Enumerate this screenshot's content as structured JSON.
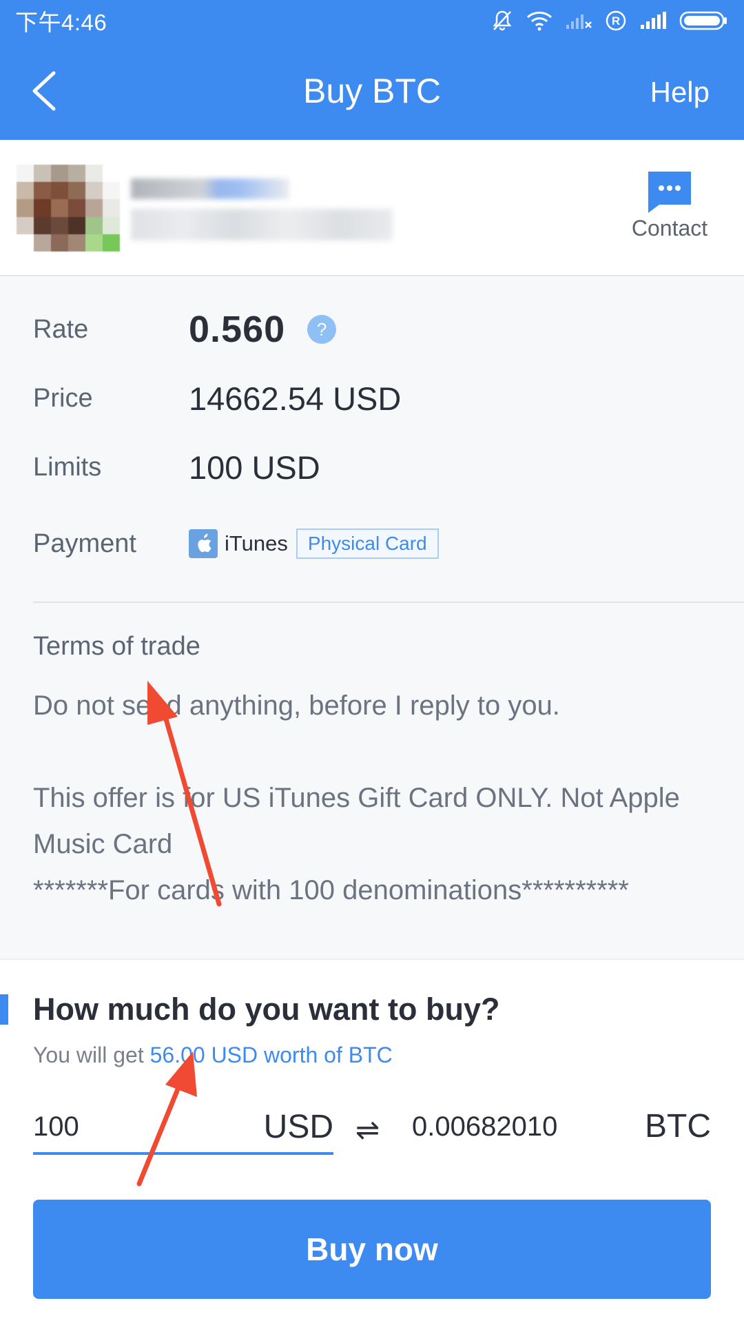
{
  "status_bar": {
    "time": "下午4:46"
  },
  "header": {
    "title": "Buy BTC",
    "help": "Help"
  },
  "seller": {
    "contact_label": "Contact"
  },
  "details": {
    "rate_label": "Rate",
    "rate_value": "0.560",
    "rate_help": "?",
    "price_label": "Price",
    "price_value": "14662.54 USD",
    "limits_label": "Limits",
    "limits_value": "100 USD",
    "payment_label": "Payment",
    "payment_method": "iTunes",
    "payment_tag": "Physical Card",
    "terms_title": "Terms of trade",
    "terms_lines": [
      "Do not send anything, before I reply to you.",
      "This offer is for US iTunes Gift Card ONLY. Not Apple Music Card",
      "*******For cards with 100 denominations**********"
    ]
  },
  "buy": {
    "heading": "How much do you want to buy?",
    "get_prefix": "You will get ",
    "get_highlight": "56.00 USD worth of BTC",
    "amount_value": "100",
    "amount_currency": "USD",
    "swap_symbol": "⇌",
    "btc_amount": "0.00682010",
    "btc_currency": "BTC",
    "button_label": "Buy now"
  },
  "colors": {
    "brand": "#3d8bf0",
    "annotation": "#f04a32"
  }
}
